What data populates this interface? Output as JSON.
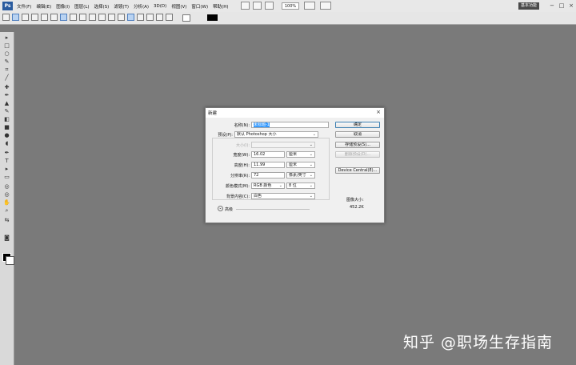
{
  "app": {
    "logo": "Ps",
    "zoom": "100%",
    "workspace": "基本功能"
  },
  "menu": [
    "文件(F)",
    "编辑(E)",
    "图像(I)",
    "图层(L)",
    "选择(S)",
    "滤镜(T)",
    "分析(A)",
    "3D(D)",
    "视图(V)",
    "窗口(W)",
    "帮助(H)"
  ],
  "window_controls": {
    "minimize": "−",
    "restore": "□",
    "close": "×"
  },
  "colors": {
    "foreground": "#000000",
    "background": "#ffffff",
    "primary_button_border": "#3c7fb1",
    "selection": "#3399ff"
  },
  "dialog": {
    "title": "新建",
    "close": "×",
    "name_label": "名称(N):",
    "name_value": "未标题-1",
    "preset_label": "预设(P):",
    "preset_value": "默认 Photoshop 大小",
    "size_label": "大小(I):",
    "width_label": "宽度(W):",
    "width_value": "16.02",
    "width_unit": "厘米",
    "height_label": "高度(H):",
    "height_value": "11.99",
    "height_unit": "厘米",
    "resolution_label": "分辨率(R):",
    "resolution_value": "72",
    "resolution_unit": "像素/英寸",
    "color_mode_label": "颜色模式(M):",
    "color_mode_value": "RGB 颜色",
    "bit_depth_value": "8 位",
    "bg_label": "背景内容(C):",
    "bg_value": "白色",
    "advanced_label": "高级",
    "advanced_icon": "chevron-down",
    "buttons": {
      "ok": "确定",
      "cancel": "取消",
      "save_preset": "存储预设(S)...",
      "delete_preset": "删除预设(D)...",
      "device_central": "Device Central(E)..."
    },
    "image_size_label": "图像大小:",
    "image_size_value": "452.2K"
  },
  "watermark": "知乎 @职场生存指南"
}
